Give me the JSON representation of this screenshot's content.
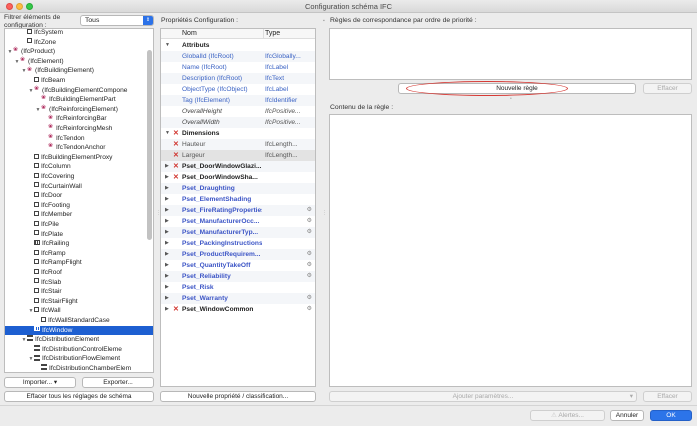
{
  "window": {
    "title": "Configuration schéma IFC"
  },
  "left": {
    "filter_label_line1": "Filtrer éléments de",
    "filter_label_line2": "configuration :",
    "filter_value": "Tous",
    "tree": [
      {
        "label": "IfcSystem",
        "depth": 2,
        "icon": "box",
        "arrow": ""
      },
      {
        "label": "IfcZone",
        "depth": 2,
        "icon": "box",
        "arrow": ""
      },
      {
        "label": "(IfcProduct)",
        "depth": 0,
        "icon": "pink",
        "arrow": "down"
      },
      {
        "label": "(IfcElement)",
        "depth": 1,
        "icon": "pink",
        "arrow": "down"
      },
      {
        "label": "(IfcBuildingElement)",
        "depth": 2,
        "icon": "pink",
        "arrow": "down"
      },
      {
        "label": "IfcBeam",
        "depth": 3,
        "icon": "box",
        "arrow": ""
      },
      {
        "label": "(IfcBuildingElementCompone",
        "depth": 3,
        "icon": "pink",
        "arrow": "down"
      },
      {
        "label": "IfcBuildingElementPart",
        "depth": 4,
        "icon": "pink",
        "arrow": ""
      },
      {
        "label": "(IfcReinforcingElement)",
        "depth": 4,
        "icon": "pink",
        "arrow": "down"
      },
      {
        "label": "IfcReinforcingBar",
        "depth": 5,
        "icon": "pink",
        "arrow": ""
      },
      {
        "label": "IfcReinforcingMesh",
        "depth": 5,
        "icon": "pink",
        "arrow": ""
      },
      {
        "label": "IfcTendon",
        "depth": 5,
        "icon": "pink",
        "arrow": ""
      },
      {
        "label": "IfcTendonAnchor",
        "depth": 5,
        "icon": "pink",
        "arrow": ""
      },
      {
        "label": "IfcBuildingElementProxy",
        "depth": 3,
        "icon": "box",
        "arrow": ""
      },
      {
        "label": "IfcColumn",
        "depth": 3,
        "icon": "box",
        "arrow": ""
      },
      {
        "label": "IfcCovering",
        "depth": 3,
        "icon": "box",
        "arrow": ""
      },
      {
        "label": "IfcCurtainWall",
        "depth": 3,
        "icon": "box",
        "arrow": ""
      },
      {
        "label": "IfcDoor",
        "depth": 3,
        "icon": "box",
        "arrow": ""
      },
      {
        "label": "IfcFooting",
        "depth": 3,
        "icon": "box",
        "arrow": ""
      },
      {
        "label": "IfcMember",
        "depth": 3,
        "icon": "box",
        "arrow": ""
      },
      {
        "label": "IfcPile",
        "depth": 3,
        "icon": "box",
        "arrow": ""
      },
      {
        "label": "IfcPlate",
        "depth": 3,
        "icon": "box",
        "arrow": ""
      },
      {
        "label": "IfcRailing",
        "depth": 3,
        "icon": "grid",
        "arrow": ""
      },
      {
        "label": "IfcRamp",
        "depth": 3,
        "icon": "box",
        "arrow": ""
      },
      {
        "label": "IfcRampFlight",
        "depth": 3,
        "icon": "box",
        "arrow": ""
      },
      {
        "label": "IfcRoof",
        "depth": 3,
        "icon": "box",
        "arrow": ""
      },
      {
        "label": "IfcSlab",
        "depth": 3,
        "icon": "box",
        "arrow": ""
      },
      {
        "label": "IfcStair",
        "depth": 3,
        "icon": "box",
        "arrow": ""
      },
      {
        "label": "IfcStairFlight",
        "depth": 3,
        "icon": "box",
        "arrow": ""
      },
      {
        "label": "IfcWall",
        "depth": 3,
        "icon": "box",
        "arrow": "down"
      },
      {
        "label": "IfcWallStandardCase",
        "depth": 4,
        "icon": "box",
        "arrow": ""
      },
      {
        "label": "IfcWindow",
        "depth": 3,
        "icon": "grid",
        "arrow": "",
        "selected": true
      },
      {
        "label": "IfcDistributionElement",
        "depth": 2,
        "icon": "stack",
        "arrow": "down"
      },
      {
        "label": "IfcDistributionControlEleme",
        "depth": 3,
        "icon": "stack",
        "arrow": ""
      },
      {
        "label": "IfcDistributionFlowElement",
        "depth": 3,
        "icon": "stack",
        "arrow": "down"
      },
      {
        "label": "IfcDistributionChamberElem",
        "depth": 4,
        "icon": "stack",
        "arrow": ""
      }
    ],
    "import_label": "Importer...",
    "export_label": "Exporter...",
    "clear_label": "Effacer tous les réglages de schéma"
  },
  "middle": {
    "header": "Propriétés Configuration :",
    "col_name": "Nom",
    "col_type": "Type",
    "rows": [
      {
        "kind": "group",
        "name": "Attributs",
        "expanded": true
      },
      {
        "kind": "link",
        "name": "GlobalId (IfcRoot)",
        "type": "IfcGlobally..."
      },
      {
        "kind": "link",
        "name": "Name (IfcRoot)",
        "type": "IfcLabel"
      },
      {
        "kind": "link",
        "name": "Description (IfcRoot)",
        "type": "IfcText"
      },
      {
        "kind": "link",
        "name": "ObjectType (IfcObject)",
        "type": "IfcLabel"
      },
      {
        "kind": "link",
        "name": "Tag (IfcElement)",
        "type": "IfcIdentifier"
      },
      {
        "kind": "ital",
        "name": "OverallHeight",
        "type": "IfcPositive..."
      },
      {
        "kind": "ital",
        "name": "OverallWidth",
        "type": "IfcPositive..."
      },
      {
        "kind": "group",
        "name": "Dimensions",
        "expanded": true,
        "x": true
      },
      {
        "kind": "plain",
        "name": "Hauteur",
        "type": "IfcLength...",
        "x": true
      },
      {
        "kind": "plain",
        "name": "Largeur",
        "type": "IfcLength...",
        "x": true,
        "selected": true
      },
      {
        "kind": "group",
        "name": "Pset_DoorWindowGlazi...",
        "x": true
      },
      {
        "kind": "group",
        "name": "Pset_DoorWindowSha...",
        "x": true
      },
      {
        "kind": "pset",
        "name": "Pset_Draughting"
      },
      {
        "kind": "pset",
        "name": "Pset_ElementShading"
      },
      {
        "kind": "pset",
        "name": "Pset_FireRatingProperties",
        "gear": true
      },
      {
        "kind": "pset",
        "name": "Pset_ManufacturerOcc...",
        "gear": true
      },
      {
        "kind": "pset",
        "name": "Pset_ManufacturerTyp...",
        "gear": true
      },
      {
        "kind": "pset",
        "name": "Pset_PackingInstructions"
      },
      {
        "kind": "pset",
        "name": "Pset_ProductRequirem...",
        "gear": true
      },
      {
        "kind": "pset",
        "name": "Pset_QuantityTakeOff",
        "gear": true
      },
      {
        "kind": "pset",
        "name": "Pset_Reliability",
        "gear": true
      },
      {
        "kind": "pset",
        "name": "Pset_Risk"
      },
      {
        "kind": "pset",
        "name": "Pset_Warranty",
        "gear": true
      },
      {
        "kind": "group",
        "name": "Pset_WindowCommon",
        "x": true,
        "gear": true
      }
    ],
    "new_prop_label": "Nouvelle propriété / classification..."
  },
  "right": {
    "rules_header": "Règles de correspondance par ordre de priorité :",
    "new_rule_label": "Nouvelle règle",
    "delete_label": "Effacer",
    "content_header": "Contenu de la règle :",
    "add_params_label": "Ajouter paramètres...",
    "delete2_label": "Effacer"
  },
  "footer": {
    "alerts_label": "Alertes...",
    "cancel_label": "Annuler",
    "ok_label": "OK"
  },
  "colors": {
    "selection": "#1d5fd1",
    "accent": "#2c74e9",
    "highlight_oval": "#d63a35"
  }
}
